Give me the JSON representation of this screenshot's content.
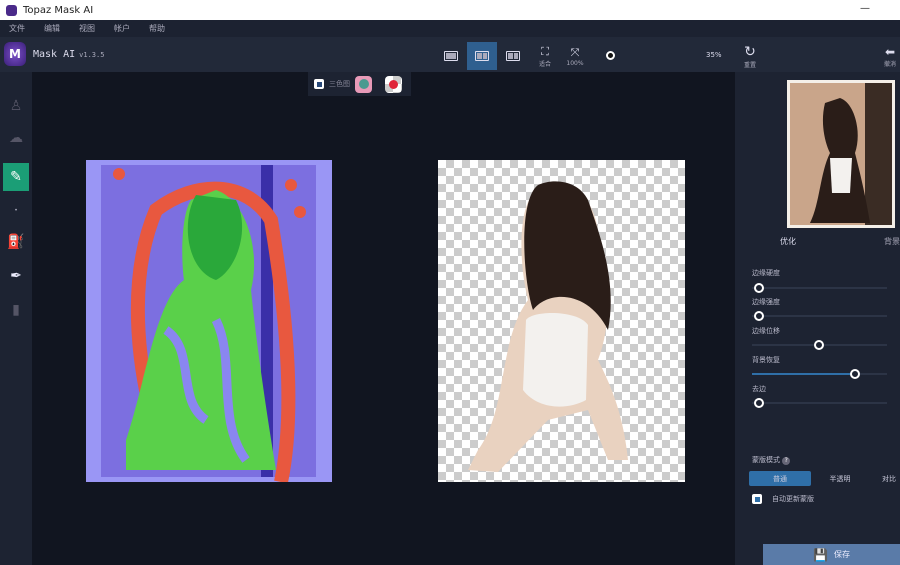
{
  "window": {
    "title": "Topaz Mask AI"
  },
  "menu": [
    "文件",
    "编辑",
    "视图",
    "帐户",
    "帮助"
  ],
  "header": {
    "logo_letter": "M",
    "app_name": "Mask AI",
    "version": "v1.3.5"
  },
  "toolbar": {
    "fit_label": "适合",
    "full_label": "100%",
    "zoom_value": "35%",
    "reset_label": "重置",
    "undo_label": "撤消",
    "zoom_level_pct": 35
  },
  "subbar": {
    "trimap_label": "三色图"
  },
  "right_panel": {
    "tabs": [
      "优化",
      "背景"
    ],
    "sliders": [
      {
        "label": "边缘硬度",
        "value": 0
      },
      {
        "label": "边缘强度",
        "value": 0
      },
      {
        "label": "边缘位移",
        "value": 50
      },
      {
        "label": "背景恢复",
        "value": 76
      },
      {
        "label": "去边",
        "value": 0
      }
    ],
    "mask_mode_label": "蒙版模式",
    "modes": [
      "普通",
      "半透明",
      "对比"
    ],
    "auto_update_label": "自动更新蒙版",
    "save_label": "保存"
  },
  "colors": {
    "accent": "#1b9e76",
    "selected": "#2f5f8f",
    "keep": "#4fd04a",
    "cut": "#e8583f",
    "mask": "#8a86f0"
  }
}
